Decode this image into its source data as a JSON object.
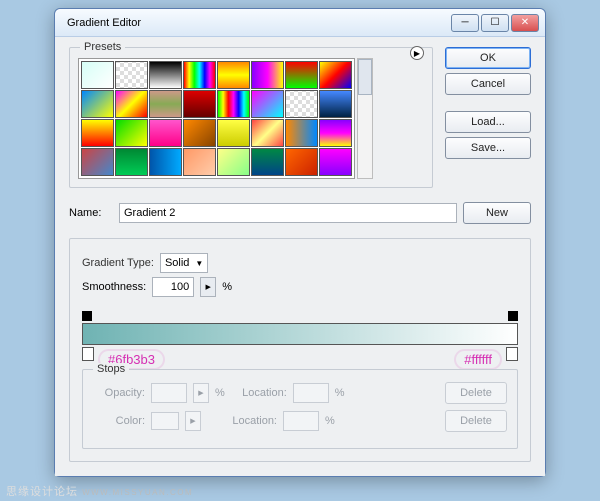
{
  "title": "Gradient Editor",
  "buttons": {
    "ok": "OK",
    "cancel": "Cancel",
    "load": "Load...",
    "save": "Save...",
    "new": "New",
    "delete": "Delete"
  },
  "presets": {
    "legend": "Presets",
    "swatches": [
      "linear-gradient(135deg,#d6fff6,#ffffff)",
      "repeating-conic-gradient(#ddd 0 25%,#fff 0 50%) 0/8px 8px",
      "linear-gradient(#000,#fff)",
      "linear-gradient(90deg,#f00,#ff0,#0f0,#0ff,#00f,#f0f,#f00)",
      "linear-gradient(#f80,#ff0,#f80)",
      "linear-gradient(90deg,#80f,#f0f,#ff0)",
      "linear-gradient(#f00,#0f0)",
      "linear-gradient(135deg,#ff0,#f00,#00f)",
      "linear-gradient(135deg,#08f,#ff0)",
      "linear-gradient(135deg,#f0f,#ff0,#f00)",
      "linear-gradient(#c98,#8a5,#c98)",
      "linear-gradient(#d00,#600)",
      "linear-gradient(90deg,#0f0,#ff0,#f00,#f0f,#00f,#0ff,#0f0)",
      "linear-gradient(135deg,#f0f,#0ff)",
      "repeating-conic-gradient(#ddd 0 25%,#fff 0 50%) 0/8px 8px",
      "linear-gradient(#48f,#024)",
      "linear-gradient(#ff0,#f00)",
      "linear-gradient(135deg,#0d0,#ff0)",
      "linear-gradient(#f5c,#f08)",
      "linear-gradient(135deg,#f80,#840)",
      "linear-gradient(#ff4,#cc0)",
      "linear-gradient(135deg,#f44,#ff8,#f44)",
      "linear-gradient(90deg,#f80,#08f)",
      "linear-gradient(#80f,#f0f,#ff0)",
      "linear-gradient(135deg,#c44,#48c)",
      "linear-gradient(#083,#0c5)",
      "linear-gradient(90deg,#05a,#0af)",
      "linear-gradient(135deg,#f96,#fca)",
      "linear-gradient(135deg,#ff8,#8f8)",
      "linear-gradient(#084,#048)",
      "linear-gradient(135deg,#f60,#c20)",
      "linear-gradient(#f0f,#80f)"
    ]
  },
  "name": {
    "label": "Name:",
    "value": "Gradient 2"
  },
  "gradient_type": {
    "label": "Gradient Type:",
    "value": "Solid"
  },
  "smoothness": {
    "label": "Smoothness:",
    "value": "100",
    "unit": "%"
  },
  "gradient": {
    "stops": [
      {
        "position": 0,
        "color": "#6fb3b3"
      },
      {
        "position": 100,
        "color": "#ffffff"
      }
    ],
    "annotations": {
      "left": "#6fb3b3",
      "right": "#ffffff"
    }
  },
  "stops_panel": {
    "legend": "Stops",
    "opacity_label": "Opacity:",
    "color_label": "Color:",
    "location_label": "Location:",
    "unit": "%"
  },
  "footer": {
    "main": "思缘设计论坛",
    "sub": "WWW.MISSYUAN.COM"
  }
}
